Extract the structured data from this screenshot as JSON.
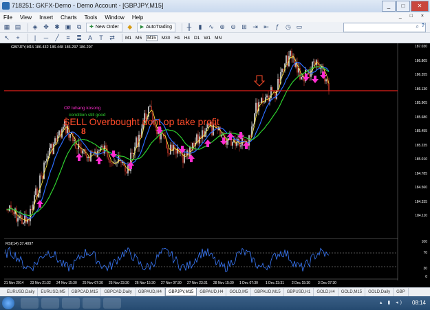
{
  "window": {
    "title": "718251: GKFX-Demo - Demo Account - [GBPJPY,M15]",
    "buttons": [
      "_",
      "□",
      "✕"
    ]
  },
  "menu": {
    "items": [
      "File",
      "View",
      "Insert",
      "Charts",
      "Tools",
      "Window",
      "Help"
    ],
    "right_controls": "_ □ ×"
  },
  "toolbar": {
    "new_order_label": "New Order",
    "autotrading_label": "AutoTrading",
    "timeframes": [
      "M1",
      "M5",
      "M15",
      "M30",
      "H1",
      "H4",
      "D1",
      "W1",
      "MN"
    ],
    "search_placeholder": ""
  },
  "chart": {
    "info_line": "GBPJPY,M15  186.432 186.448 186.297 186.297",
    "price_ticks": [
      "187.030",
      "186.805",
      "186.355",
      "186.130",
      "185.905",
      "185.680",
      "185.455",
      "185.235",
      "185.010",
      "184.785",
      "184.560",
      "184.335",
      "184.110"
    ],
    "rsi_label": "RSI(14) 37.4097",
    "rsi_ticks": [
      "100",
      "70",
      "30",
      "0"
    ],
    "dates": [
      "21 Nov 2014",
      "23 Nov 21:32",
      "24 Nov 15:30",
      "25 Nov 07:30",
      "25 Nov 23:30",
      "26 Nov 15:30",
      "27 Nov 07:30",
      "27 Nov 23:31",
      "28 Nov 15:30",
      "1 Dec 07:30",
      "1 Dec 23:31",
      "2 Dec 15:30",
      "3 Dec 07:30"
    ],
    "annotation_op": "OP luhang kosong",
    "annotation_condition": "condition still good",
    "annotation_sell": "SELL Overbought dont op take profit",
    "annotation_oo": "8",
    "colors": {
      "background": "#000000",
      "bull_candle": "#ffffff",
      "bear_candle": "#cc3a2a",
      "ma_fast": "#ffeb3b",
      "ma_mid": "#2b6cff",
      "ma_slow": "#2fd22f",
      "resistance": "#e0201a",
      "arrows": "#ff2dd0",
      "rsi_line": "#3a7bff"
    }
  },
  "symbol_tabs": [
    "EURUSD,Daily",
    "EURUSD,M5",
    "GBPCAD,M15",
    "GBPCAD,Daily",
    "GBPAUD,H4",
    "GBPJPY,M15",
    "GBPAUD,H4",
    "GOLD,M5",
    "GBPAUD,M15",
    "GBPUSD,H1",
    "GOLD,H4",
    "GOLD,M15",
    "GOLD,Daily",
    "GBP"
  ],
  "active_symbol_tab": "GBPJPY,M15",
  "taskbar": {
    "clock": "08:14"
  }
}
